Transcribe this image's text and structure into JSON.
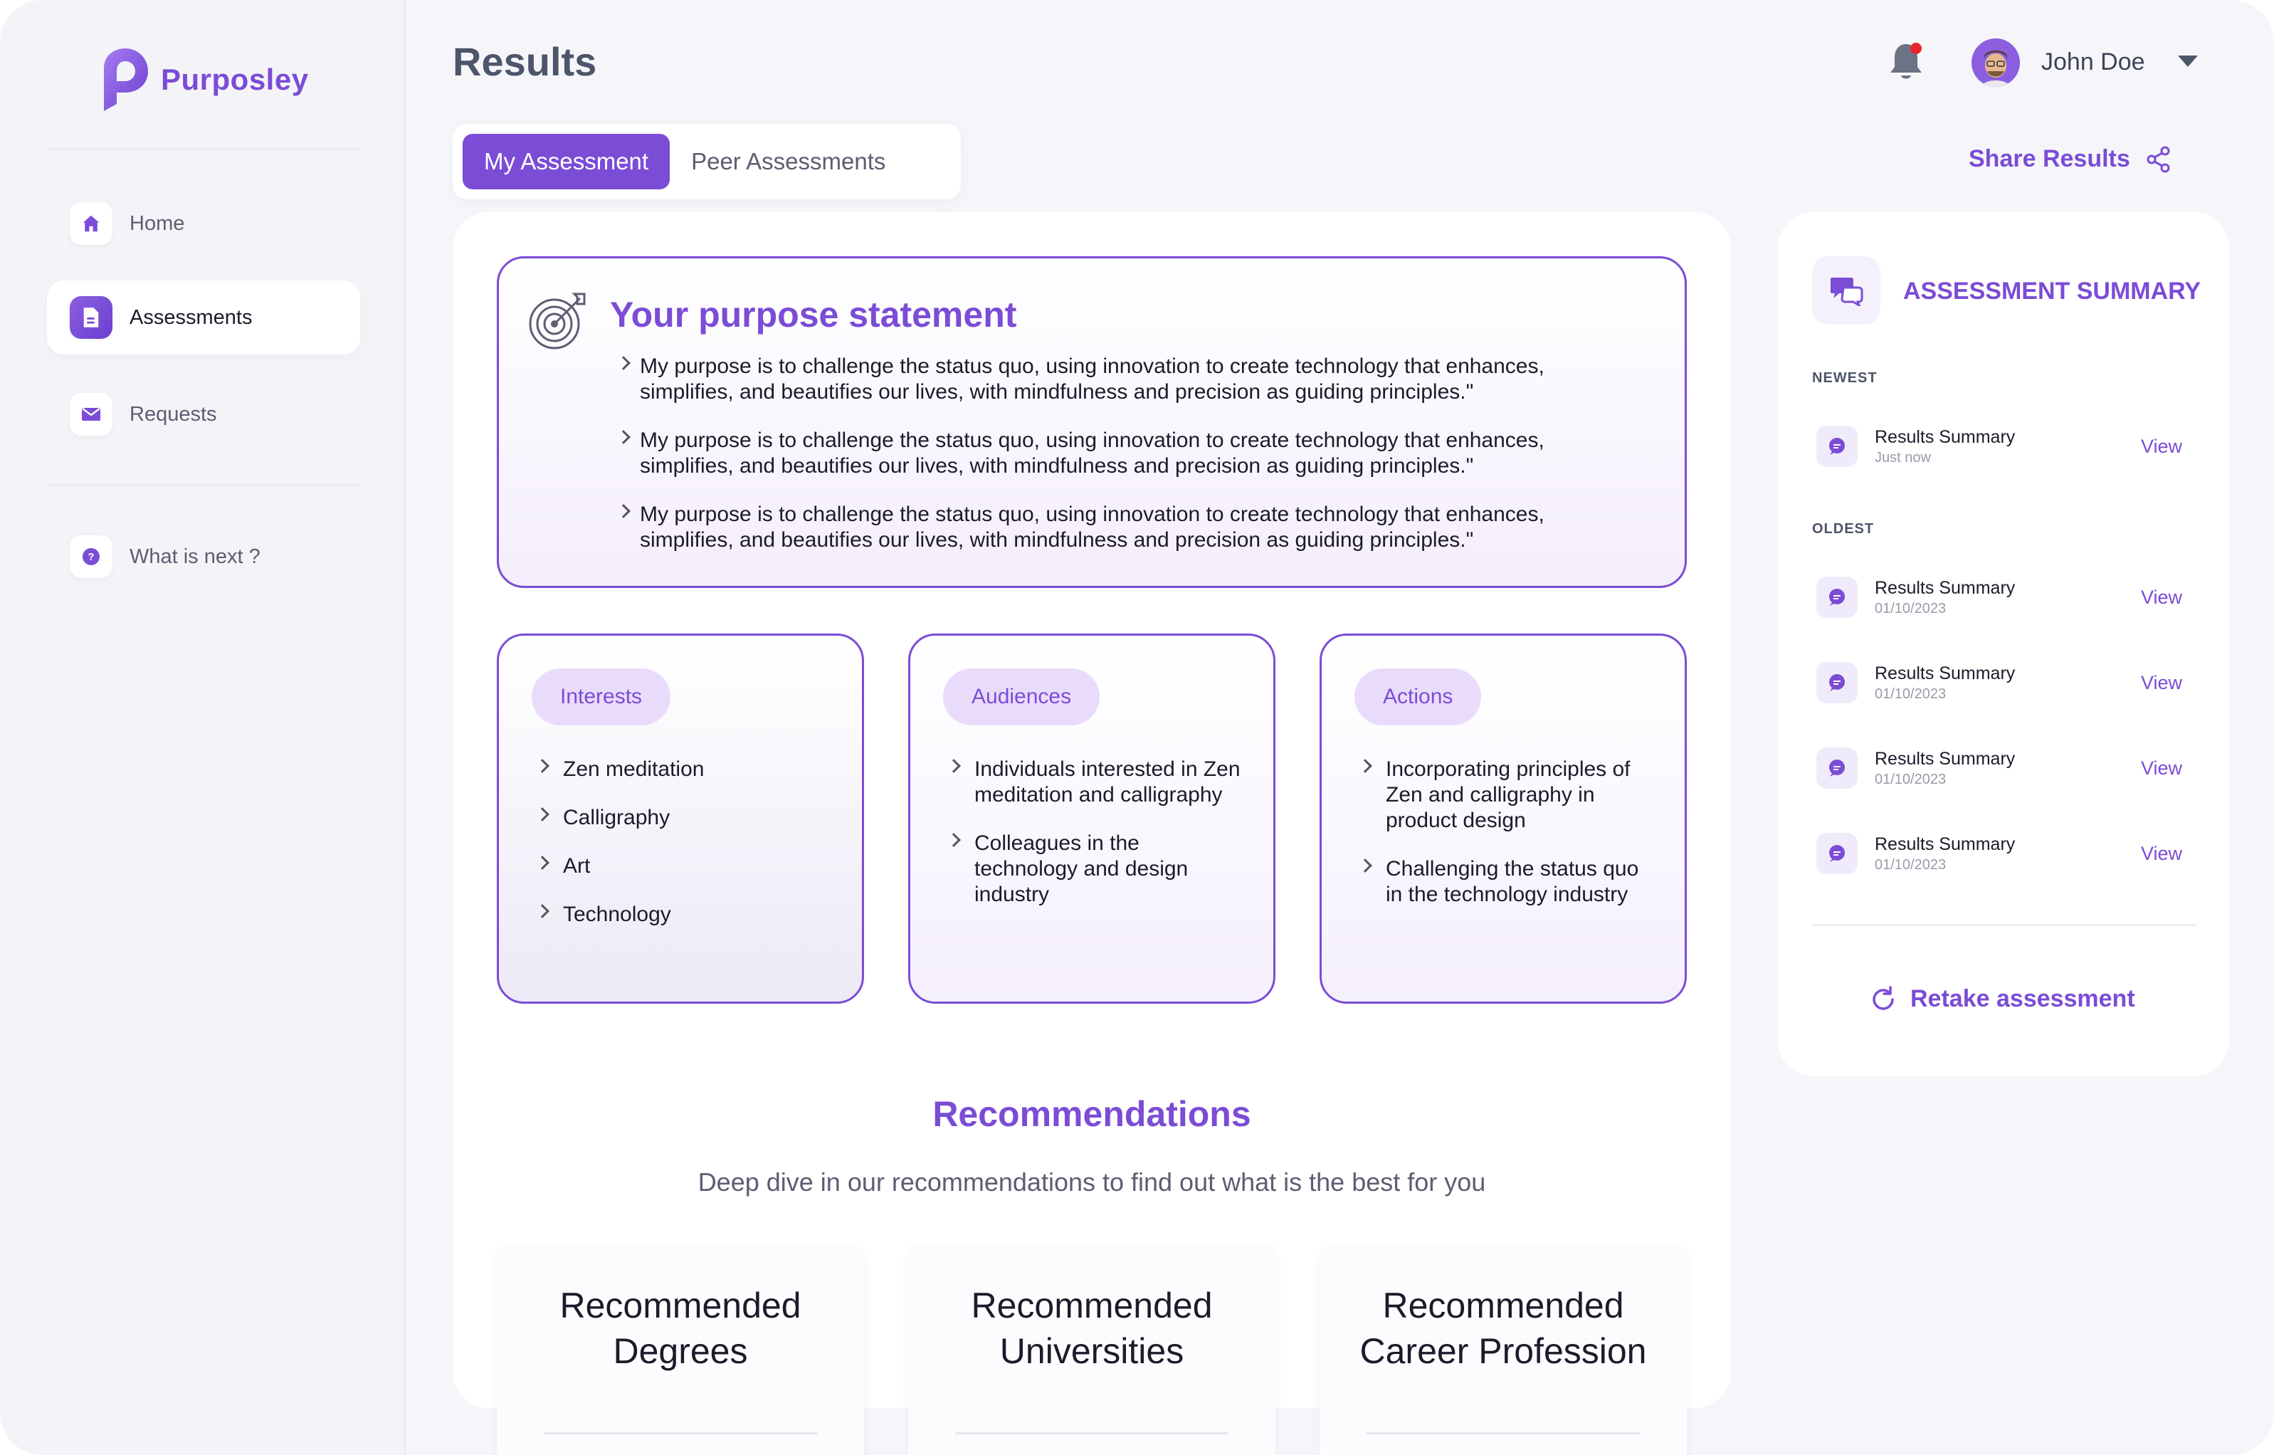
{
  "app": {
    "name": "Purposley",
    "accent": "#7b4cd6"
  },
  "sidebar": {
    "items": [
      {
        "label": "Home",
        "icon": "home-icon",
        "active": false
      },
      {
        "label": "Assessments",
        "icon": "document-icon",
        "active": true
      },
      {
        "label": "Requests",
        "icon": "envelope-icon",
        "active": false
      },
      {
        "label": "What is next ?",
        "icon": "help-icon",
        "active": false
      }
    ]
  },
  "header": {
    "title": "Results",
    "notification_icon": "bell-icon",
    "user_name": "John Doe"
  },
  "tabs": [
    {
      "label": "My Assessment",
      "active": true
    },
    {
      "label": "Peer Assessments",
      "active": false
    }
  ],
  "share_label": "Share Results",
  "purpose": {
    "title": "Your purpose statement",
    "items": [
      "My purpose is to challenge the status quo, using innovation to create technology that enhances, simplifies, and beautifies our lives, with mindfulness and precision as guiding principles.\"",
      "My purpose is to challenge the status quo, using innovation to create technology that enhances, simplifies, and beautifies our lives, with mindfulness and precision as guiding principles.\"",
      "My purpose is to challenge the status quo, using innovation to create technology that enhances, simplifies, and beautifies our lives, with mindfulness and precision as guiding principles.\""
    ]
  },
  "interests": {
    "label": "Interests",
    "items": [
      "Zen meditation",
      "Calligraphy",
      "Art",
      "Technology"
    ]
  },
  "audiences": {
    "label": "Audiences",
    "items": [
      "Individuals interested in Zen meditation and calligraphy",
      "Colleagues in the technology and design industry"
    ]
  },
  "actions": {
    "label": "Actions",
    "items": [
      "Incorporating principles of Zen and calligraphy in product design",
      "Challenging the status quo in the technology industry"
    ]
  },
  "recommendations": {
    "title": "Recommendations",
    "subtitle": "Deep dive in our recommendations to find out what is the best for you",
    "cards": [
      {
        "line1": "Recommended",
        "line2": "Degrees"
      },
      {
        "line1": "Recommended",
        "line2": "Universities"
      },
      {
        "line1": "Recommended",
        "line2": "Career Profession"
      }
    ]
  },
  "summary": {
    "title": "ASSESSMENT SUMMARY",
    "newest_label": "NEWEST",
    "oldest_label": "OLDEST",
    "view_label": "View",
    "newest": [
      {
        "name": "Results Summary",
        "date": "Just now"
      }
    ],
    "oldest": [
      {
        "name": "Results Summary",
        "date": "01/10/2023"
      },
      {
        "name": "Results Summary",
        "date": "01/10/2023"
      },
      {
        "name": "Results Summary",
        "date": "01/10/2023"
      },
      {
        "name": "Results Summary",
        "date": "01/10/2023"
      }
    ],
    "retake_label": "Retake assessment"
  }
}
